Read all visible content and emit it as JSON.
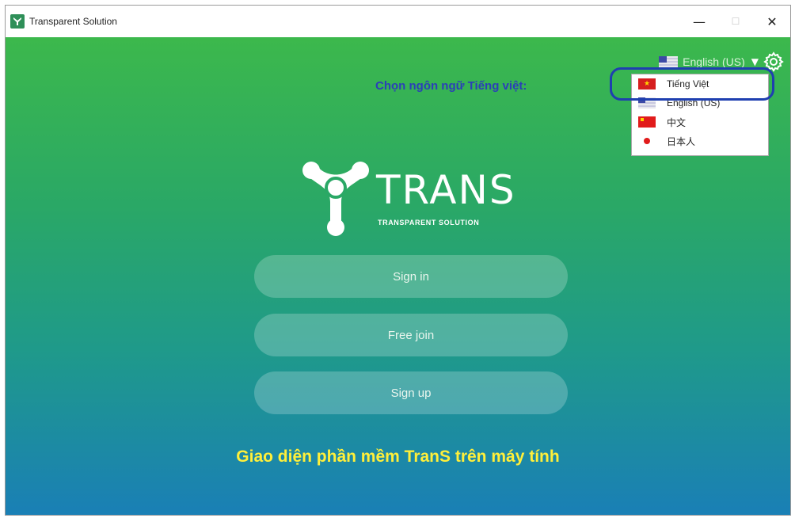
{
  "window": {
    "title": "Transparent Solution",
    "controls": {
      "minimize": "—",
      "maximize": "☐",
      "close": "✕"
    }
  },
  "language": {
    "current": "English (US)",
    "caret": "▼",
    "hint": "Chọn ngôn ngữ Tiếng việt:",
    "options": [
      {
        "label": "Tiếng Việt",
        "flag": "vn"
      },
      {
        "label": "English (US)",
        "flag": "us"
      },
      {
        "label": "中文",
        "flag": "cn"
      },
      {
        "label": "日本人",
        "flag": "jp"
      }
    ]
  },
  "logo": {
    "word": "TRANS",
    "subtitle": "TRANSPARENT SOLUTION"
  },
  "buttons": {
    "sign_in": "Sign in",
    "free_join": "Free join",
    "sign_up": "Sign up"
  },
  "caption": "Giao diện phần mềm TranS trên máy tính",
  "colors": {
    "gradient_top": "#3cb84c",
    "gradient_bottom": "#1a7fb6",
    "hint_blue": "#2b3fb8",
    "caption_yellow": "#ffef3a"
  },
  "icons": [
    "app-icon",
    "gear-icon",
    "caret-down-icon",
    "flag-vn-icon",
    "flag-us-icon",
    "flag-cn-icon",
    "flag-jp-icon",
    "trans-logo-icon"
  ]
}
